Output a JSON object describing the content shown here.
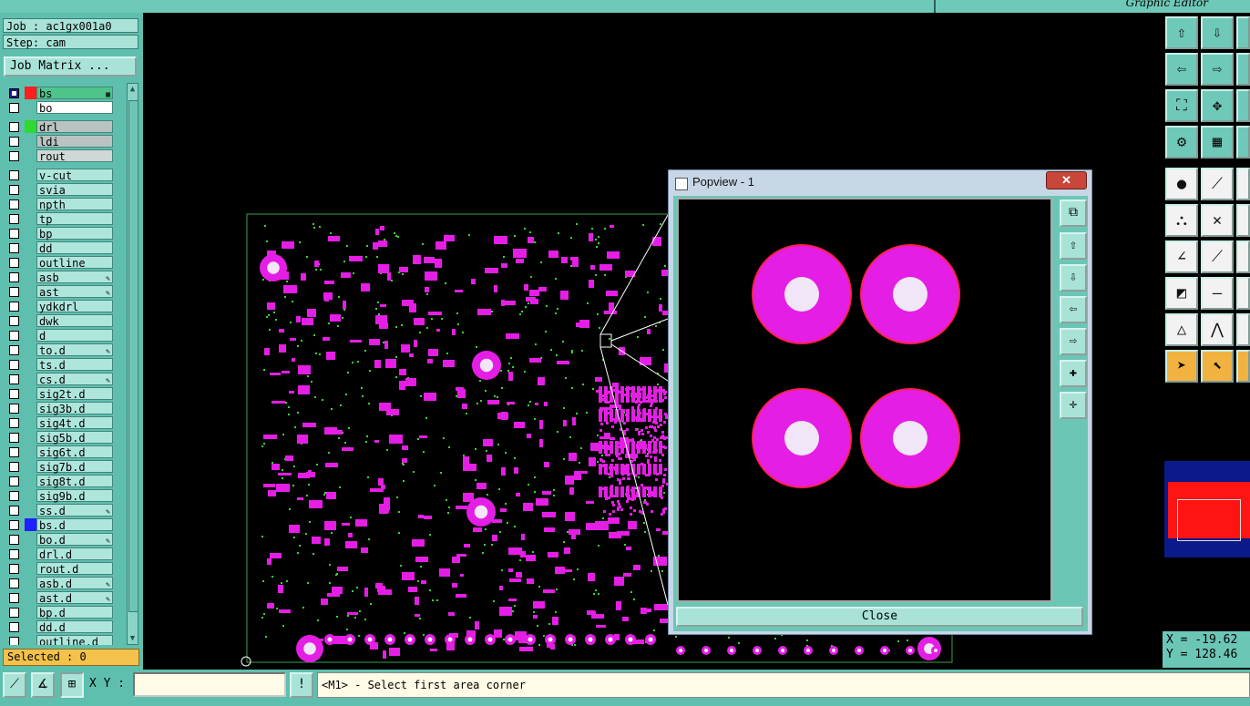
{
  "window": {
    "title": "Graphic Editor"
  },
  "job": {
    "job_label": "Job : ac1gx001a0",
    "step_label": "Step: cam",
    "job_matrix_button": "Job Matrix ..."
  },
  "layers": [
    {
      "name": "bs",
      "checked": true,
      "color": "#ff1f1f",
      "bg": "#4fc48a",
      "mark": "▦"
    },
    {
      "name": "bo",
      "checked": false,
      "color": "",
      "bg": "#ffffff",
      "mark": ""
    },
    {
      "name": "drl",
      "checked": false,
      "color": "#2fd92f",
      "bg": "#b9c4c2",
      "mark": "",
      "gap": true
    },
    {
      "name": "ldi",
      "checked": false,
      "color": "",
      "bg": "#b9c4c2",
      "mark": ""
    },
    {
      "name": "rout",
      "checked": false,
      "color": "",
      "bg": "#cfd8d6",
      "mark": ""
    },
    {
      "name": "v-cut",
      "checked": false,
      "color": "",
      "bg": "",
      "mark": "",
      "gap": true
    },
    {
      "name": "svia",
      "checked": false,
      "color": "",
      "bg": "",
      "mark": ""
    },
    {
      "name": "npth",
      "checked": false,
      "color": "",
      "bg": "",
      "mark": ""
    },
    {
      "name": "tp",
      "checked": false,
      "color": "",
      "bg": "",
      "mark": ""
    },
    {
      "name": "bp",
      "checked": false,
      "color": "",
      "bg": "",
      "mark": ""
    },
    {
      "name": "dd",
      "checked": false,
      "color": "",
      "bg": "",
      "mark": ""
    },
    {
      "name": "outline",
      "checked": false,
      "color": "",
      "bg": "",
      "mark": ""
    },
    {
      "name": "asb",
      "checked": false,
      "color": "",
      "bg": "",
      "mark": "✎"
    },
    {
      "name": "ast",
      "checked": false,
      "color": "",
      "bg": "",
      "mark": "✎"
    },
    {
      "name": "ydkdrl",
      "checked": false,
      "color": "",
      "bg": "",
      "mark": ""
    },
    {
      "name": "dwk",
      "checked": false,
      "color": "",
      "bg": "",
      "mark": ""
    },
    {
      "name": "d",
      "checked": false,
      "color": "",
      "bg": "",
      "mark": ""
    },
    {
      "name": "to.d",
      "checked": false,
      "color": "",
      "bg": "",
      "mark": "✎"
    },
    {
      "name": "ts.d",
      "checked": false,
      "color": "",
      "bg": "",
      "mark": ""
    },
    {
      "name": "cs.d",
      "checked": false,
      "color": "",
      "bg": "",
      "mark": "✎"
    },
    {
      "name": "sig2t.d",
      "checked": false,
      "color": "",
      "bg": "",
      "mark": ""
    },
    {
      "name": "sig3b.d",
      "checked": false,
      "color": "",
      "bg": "",
      "mark": ""
    },
    {
      "name": "sig4t.d",
      "checked": false,
      "color": "",
      "bg": "",
      "mark": ""
    },
    {
      "name": "sig5b.d",
      "checked": false,
      "color": "",
      "bg": "",
      "mark": ""
    },
    {
      "name": "sig6t.d",
      "checked": false,
      "color": "",
      "bg": "",
      "mark": ""
    },
    {
      "name": "sig7b.d",
      "checked": false,
      "color": "",
      "bg": "",
      "mark": ""
    },
    {
      "name": "sig8t.d",
      "checked": false,
      "color": "",
      "bg": "",
      "mark": ""
    },
    {
      "name": "sig9b.d",
      "checked": false,
      "color": "",
      "bg": "",
      "mark": ""
    },
    {
      "name": "ss.d",
      "checked": false,
      "color": "",
      "bg": "",
      "mark": "✎"
    },
    {
      "name": "bs.d",
      "checked": false,
      "color": "#2020ff",
      "bg": "",
      "mark": ""
    },
    {
      "name": "bo.d",
      "checked": false,
      "color": "",
      "bg": "",
      "mark": "✎"
    },
    {
      "name": "drl.d",
      "checked": false,
      "color": "",
      "bg": "",
      "mark": ""
    },
    {
      "name": "rout.d",
      "checked": false,
      "color": "",
      "bg": "",
      "mark": ""
    },
    {
      "name": "asb.d",
      "checked": false,
      "color": "",
      "bg": "",
      "mark": "✎"
    },
    {
      "name": "ast.d",
      "checked": false,
      "color": "",
      "bg": "",
      "mark": "✎"
    },
    {
      "name": "bp.d",
      "checked": false,
      "color": "",
      "bg": "",
      "mark": ""
    },
    {
      "name": "dd.d",
      "checked": false,
      "color": "",
      "bg": "",
      "mark": ""
    },
    {
      "name": "outline.d",
      "checked": false,
      "color": "",
      "bg": "",
      "mark": ""
    }
  ],
  "status": {
    "selected": "Selected : 0"
  },
  "bottom": {
    "xy_label": "X Y :",
    "xy_value": "",
    "message": "<M1> - Select first area corner",
    "alert_icon": "!"
  },
  "coords": {
    "x": "X = -19.62",
    "y": "Y = 128.46"
  },
  "popview": {
    "title": "Popview - 1",
    "close_label": "Close",
    "close_x": "✕"
  },
  "colors": {
    "pad": "#e51ee5",
    "pad_edge": "#ff2050",
    "hole": "#f0e6f7",
    "via_dot": "#39d439",
    "board_outline": "#3aa04a"
  }
}
